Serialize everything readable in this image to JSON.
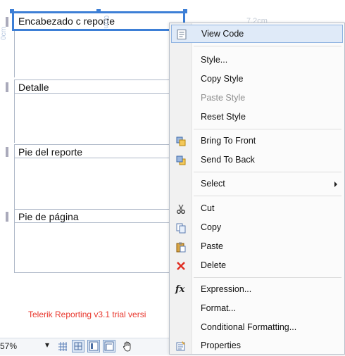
{
  "designer": {
    "bands": [
      {
        "label": "Encabezado de reporte"
      },
      {
        "label": "Detalle"
      },
      {
        "label": "Pie del reporte"
      },
      {
        "label": "Pie de página"
      }
    ],
    "selected_textbox": "Encabezado c   reporte",
    "ruler_top": "7.2cm",
    "ruler_side": "0cm",
    "ruler_mid": "0cm",
    "trial_notice": "Telerik Reporting v3.1 trial versi"
  },
  "toolbar": {
    "zoom": "57%",
    "buttons": [
      "grid-icon",
      "snap-icon",
      "layout-icon",
      "ruler-icon",
      "hand-icon"
    ]
  },
  "context_menu": {
    "items": [
      {
        "label": "View Code",
        "icon": "code-icon",
        "highlighted": true,
        "disabled": false
      },
      {
        "label": "Style...",
        "icon": "",
        "disabled": false
      },
      {
        "label": "Copy Style",
        "icon": "",
        "disabled": false
      },
      {
        "label": "Paste Style",
        "icon": "",
        "disabled": true
      },
      {
        "label": "Reset Style",
        "icon": "",
        "disabled": false
      },
      {
        "label": "Bring To Front",
        "icon": "bring-front-icon",
        "disabled": false
      },
      {
        "label": "Send To Back",
        "icon": "send-back-icon",
        "disabled": false
      },
      {
        "label": "Select",
        "icon": "",
        "disabled": false,
        "submenu": true
      },
      {
        "label": "Cut",
        "icon": "scissors-icon",
        "disabled": false
      },
      {
        "label": "Copy",
        "icon": "copy-icon",
        "disabled": false
      },
      {
        "label": "Paste",
        "icon": "paste-icon",
        "disabled": false
      },
      {
        "label": "Delete",
        "icon": "delete-icon",
        "disabled": false
      },
      {
        "label": "Expression...",
        "icon": "function-icon",
        "disabled": false
      },
      {
        "label": "Format...",
        "icon": "",
        "disabled": false
      },
      {
        "label": "Conditional Formatting...",
        "icon": "",
        "disabled": false
      },
      {
        "label": "Properties",
        "icon": "properties-icon",
        "disabled": false
      }
    ],
    "colors": {
      "highlight": "#dfeaf8",
      "delete": "#e02a1f",
      "accent": "#3d7fd6"
    }
  }
}
